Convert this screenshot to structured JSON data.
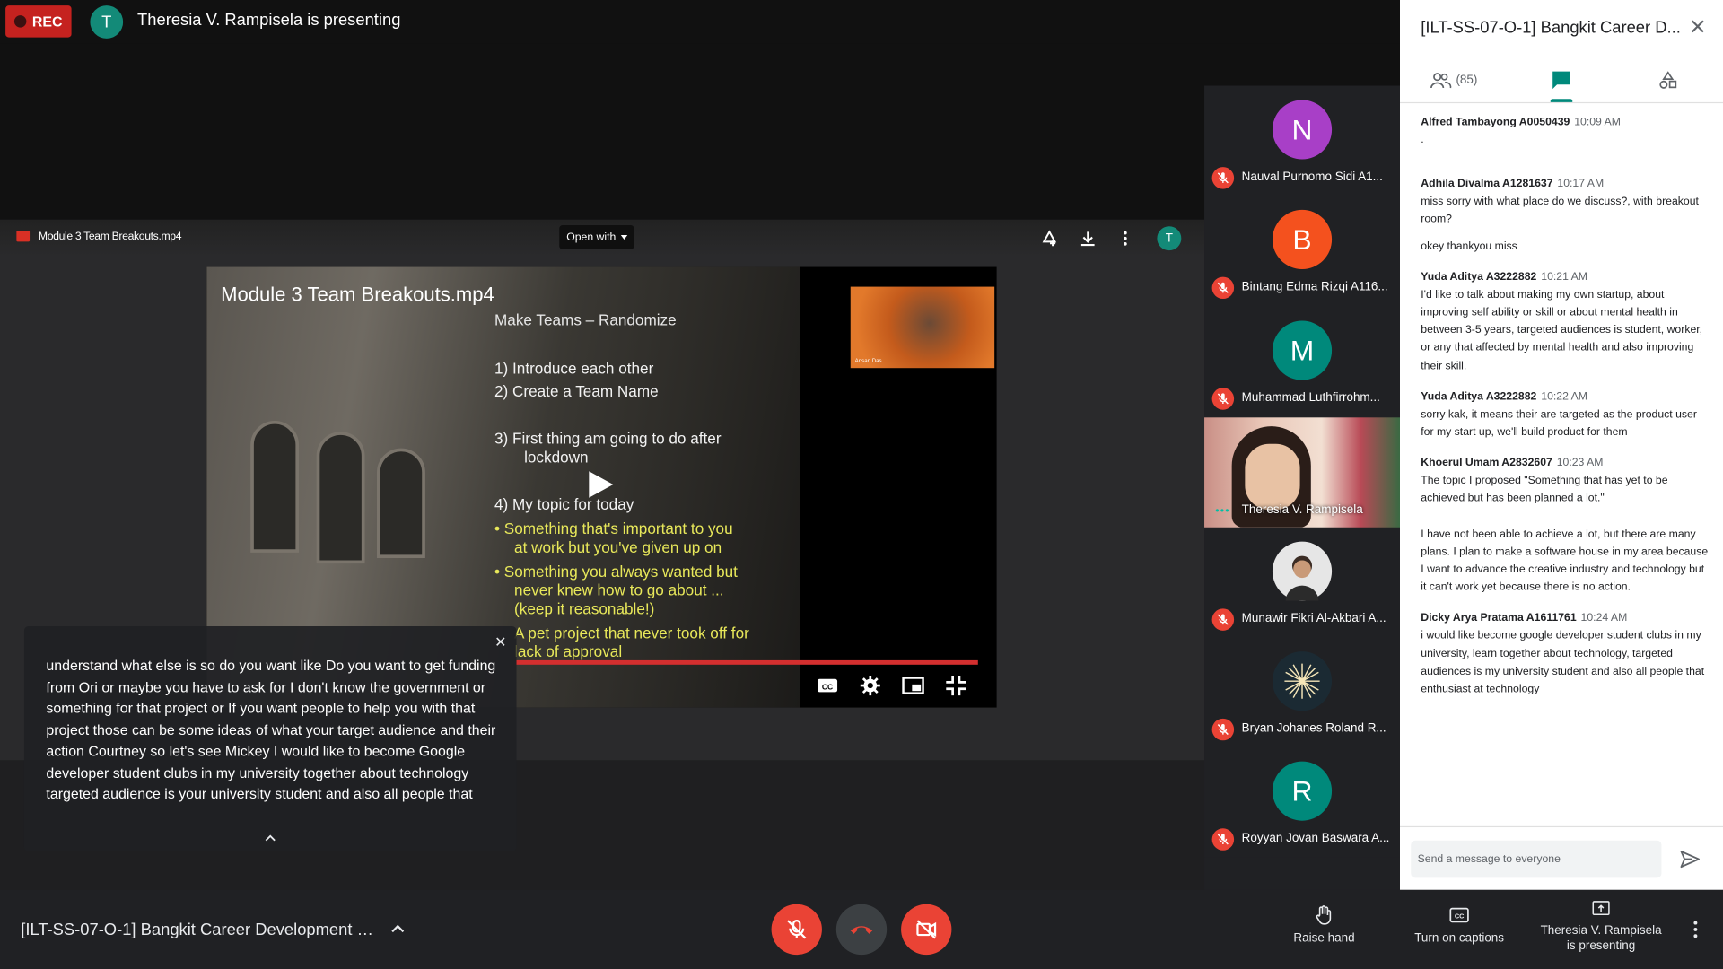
{
  "topbar": {
    "rec_label": "REC",
    "presenter_initial": "T",
    "presenting_text": "Theresia V. Rampisela is presenting"
  },
  "viewer": {
    "file_name": "Module 3 Team Breakouts.mp4",
    "open_with": "Open with",
    "user_initial": "T"
  },
  "video": {
    "title": "Module 3 Team Breakouts.mp4",
    "slide_heading": "Make Teams – Randomize",
    "slide_items": [
      "1)   Introduce each other",
      "2)   Create a Team Name",
      "3)   First thing am going to do after",
      "lockdown",
      "4)   My topic for today"
    ],
    "slide_yellow": [
      "•  Something that's important to you",
      "at work but you've given up on",
      "•  Something you always wanted but",
      "never knew how to go about ...",
      "(keep it reasonable!)",
      "A pet project that never took off for",
      "lack of approval"
    ],
    "pip_name": "Ansan Das",
    "progress": 1.0
  },
  "captions": {
    "text": "understand what else is so do you want like  Do you want to get funding from Ori or maybe you have to ask for I don't know the government or something for that project or  If you want people to help you with that project those can be some ideas of what your target audience and their action Courtney so let's see Mickey I would like to become Google developer student clubs in my university together about technology targeted audience is your university student and also all people that"
  },
  "participants": [
    {
      "initial": "N",
      "name": "Nauval Purnomo Sidi A1...",
      "color": "#a83fc7"
    },
    {
      "initial": "B",
      "name": "Bintang Edma Rizqi A116...",
      "color": "#f4511e"
    },
    {
      "initial": "M",
      "name": "Muhammad Luthfirrohm...",
      "color": "#00897b"
    },
    {
      "initial": "",
      "name": "Theresia V. Rampisela",
      "color": ""
    },
    {
      "initial": "",
      "name": "Munawir Fikri Al-Akbari A...",
      "color": "#e6e6e6"
    },
    {
      "initial": "",
      "name": "Bryan Johanes Roland R...",
      "color": "#1b2a33"
    },
    {
      "initial": "R",
      "name": "Royyan Jovan Baswara A...",
      "color": "#00897b"
    }
  ],
  "panel": {
    "title": "[ILT-SS-07-O-1] Bangkit Career D...",
    "people_count": "(85)",
    "input_placeholder": "Send a message to everyone",
    "messages": [
      {
        "name": "Alfred Tambayong A0050439",
        "time": "10:09 AM",
        "body": [
          "."
        ]
      },
      {
        "name": "Adhila Divalma A1281637",
        "time": "10:17 AM",
        "body": [
          "miss sorry with what place do we discuss?, with breakout room?",
          "okey thankyou miss"
        ]
      },
      {
        "name": "Yuda Aditya A3222882",
        "time": "10:21 AM",
        "body": [
          "I'd like to talk about making my own startup, about improving self ability or skill or about mental health in between 3-5 years, targeted audiences is student, worker, or any that affected by mental health and also improving their skill."
        ]
      },
      {
        "name": "Yuda Aditya A3222882",
        "time": "10:22 AM",
        "body": [
          "sorry kak, it means their are targeted as the product user for my start up, we'll build product for them"
        ]
      },
      {
        "name": "Khoerul Umam A2832607",
        "time": "10:23 AM",
        "body": [
          "The topic I proposed \"Something that has yet to be achieved but has been planned a lot.\"",
          "I have not been able to achieve a lot, but there are many plans. I plan to make a software house in my area because I want to advance the creative industry and technology but it can't work yet because there is no action."
        ]
      },
      {
        "name": "Dicky Arya Pratama A1611761",
        "time": "10:24 AM",
        "body": [
          "i would like become google developer student clubs in my university, learn together about technology, targeted audiences is my university student and also all people that enthusiast at technology"
        ]
      }
    ]
  },
  "bottombar": {
    "meeting_title": "[ILT-SS-07-O-1] Bangkit Career Development Cl...",
    "raise_hand": "Raise hand",
    "captions": "Turn on captions",
    "presenting_line1": "Theresia V. Rampisela",
    "presenting_line2": "is presenting",
    "colors": {
      "danger": "#ea4335",
      "accent": "#00897b"
    }
  }
}
